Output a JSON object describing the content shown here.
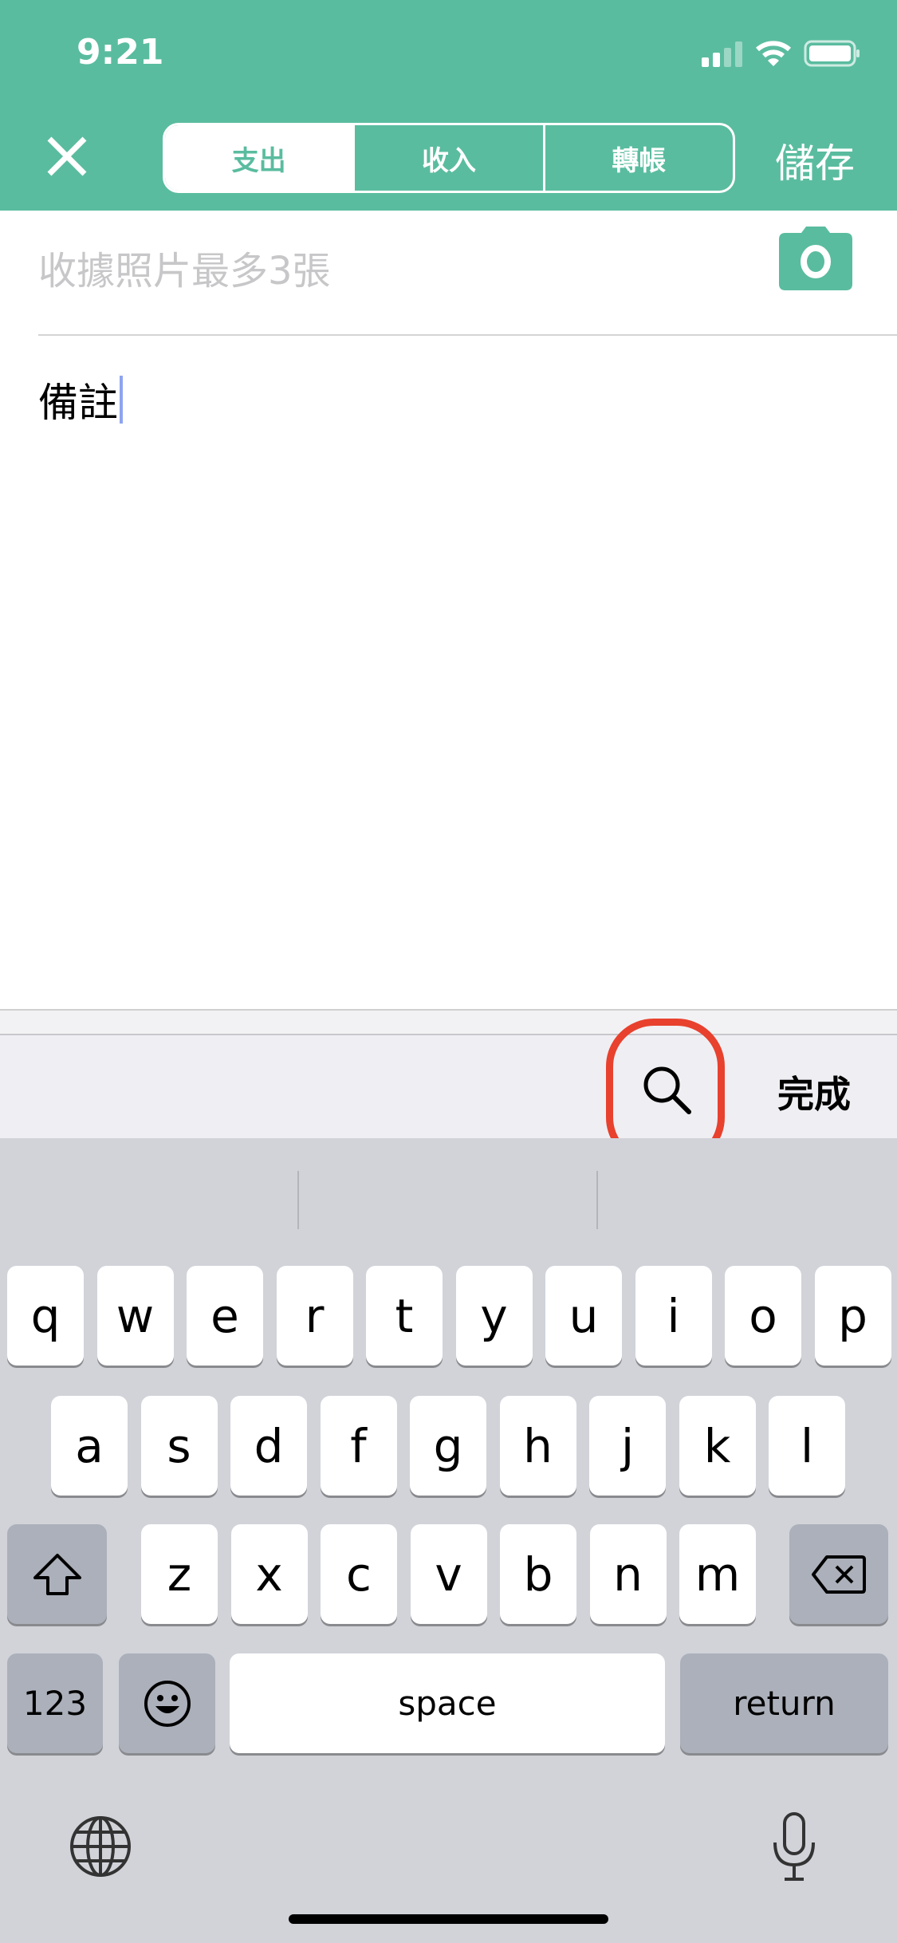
{
  "status_bar": {
    "time": "9:21"
  },
  "header": {
    "close_icon": "close-icon",
    "tabs": [
      {
        "label": "支出",
        "active": true
      },
      {
        "label": "收入",
        "active": false
      },
      {
        "label": "轉帳",
        "active": false
      }
    ],
    "save_label": "儲存",
    "accent": "#5abc9f"
  },
  "form": {
    "receipt_placeholder": "收據照片最多3張",
    "camera_icon": "camera-icon",
    "note_value": "備註"
  },
  "toolbar": {
    "search_icon": "search-icon",
    "done_label": "完成",
    "highlight_color": "#e8412e"
  },
  "keyboard": {
    "row1": [
      "q",
      "w",
      "e",
      "r",
      "t",
      "y",
      "u",
      "i",
      "o",
      "p"
    ],
    "row2": [
      "a",
      "s",
      "d",
      "f",
      "g",
      "h",
      "j",
      "k",
      "l"
    ],
    "row3": [
      "z",
      "x",
      "c",
      "v",
      "b",
      "n",
      "m"
    ],
    "numbers_label": "123",
    "space_label": "space",
    "return_label": "return"
  }
}
